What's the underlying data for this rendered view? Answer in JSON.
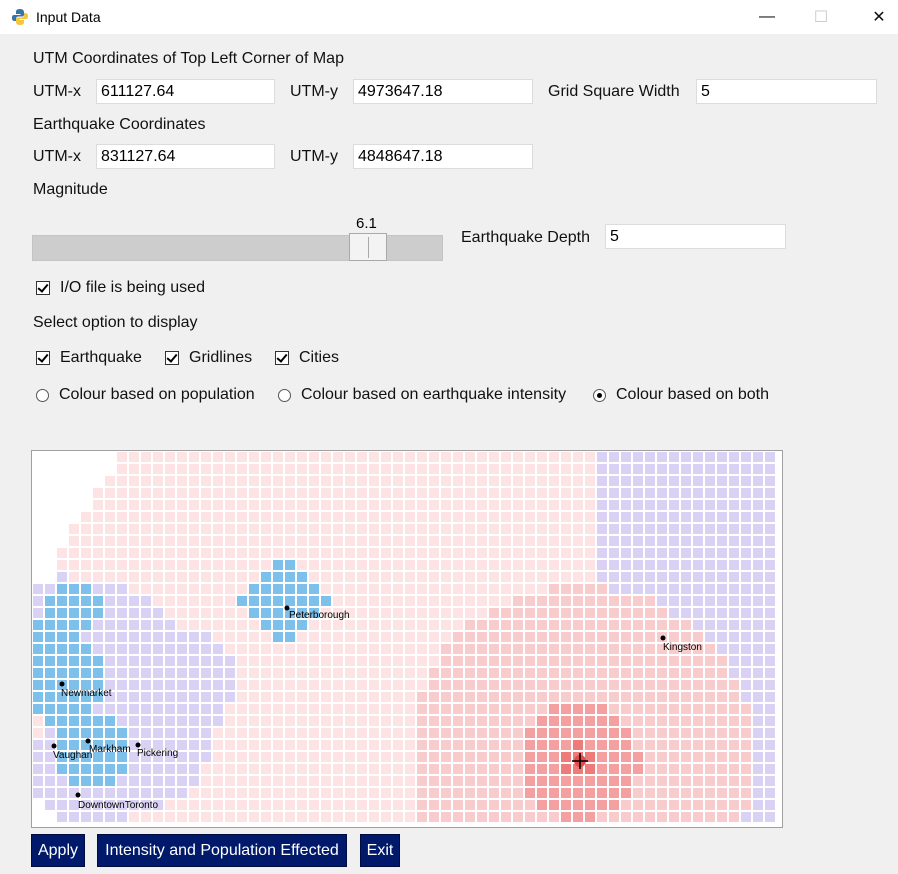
{
  "window": {
    "title": "Input Data",
    "icon": "python-icon",
    "min": "—",
    "max": "☐",
    "close": "✕"
  },
  "map_corner": {
    "heading": "UTM Coordinates of Top Left Corner of Map",
    "utmx_label": "UTM-x",
    "utmx_value": "611127.64",
    "utmy_label": "UTM-y",
    "utmy_value": "4973647.18",
    "grid_label": "Grid Square Width",
    "grid_value": "5"
  },
  "earthquake": {
    "heading": "Earthquake Coordinates",
    "utmx_label": "UTM-x",
    "utmx_value": "831127.64",
    "utmy_label": "UTM-y",
    "utmy_value": "4848647.18"
  },
  "magnitude": {
    "label": "Magnitude",
    "value_text": "6.1",
    "value": 6.1,
    "depth_label": "Earthquake Depth",
    "depth_value": "5"
  },
  "io_file": {
    "label": "I/O file is being used",
    "checked": true
  },
  "display": {
    "heading": "Select option to display",
    "checks": [
      {
        "label": "Earthquake",
        "checked": true
      },
      {
        "label": "Gridlines",
        "checked": true
      },
      {
        "label": "Cities",
        "checked": true
      }
    ],
    "radios": [
      {
        "label": "Colour based on population",
        "selected": false
      },
      {
        "label": "Colour based on earthquake intensity",
        "selected": false
      },
      {
        "label": "Colour based on both",
        "selected": true
      }
    ]
  },
  "map": {
    "cities": [
      {
        "name": "Peterborough"
      },
      {
        "name": "Kingston"
      },
      {
        "name": "Newmarket"
      },
      {
        "name": "Markham"
      },
      {
        "name": "Vaughan"
      },
      {
        "name": "Pickering"
      },
      {
        "name": "DowntownToronto"
      }
    ],
    "colors": {
      "white": "#ffffff",
      "faint_pink": "#fde3e3",
      "pink": "#f8cccc",
      "red": "#f4a0a0",
      "dark_red": "#ee7a7a",
      "lavender": "#dad2f4",
      "light_blue": "#aecdef",
      "blue": "#7ec0ec",
      "grid": "#ffffff"
    }
  },
  "buttons": {
    "apply": "Apply",
    "intensity": "Intensity and Population Effected",
    "exit": "Exit"
  }
}
